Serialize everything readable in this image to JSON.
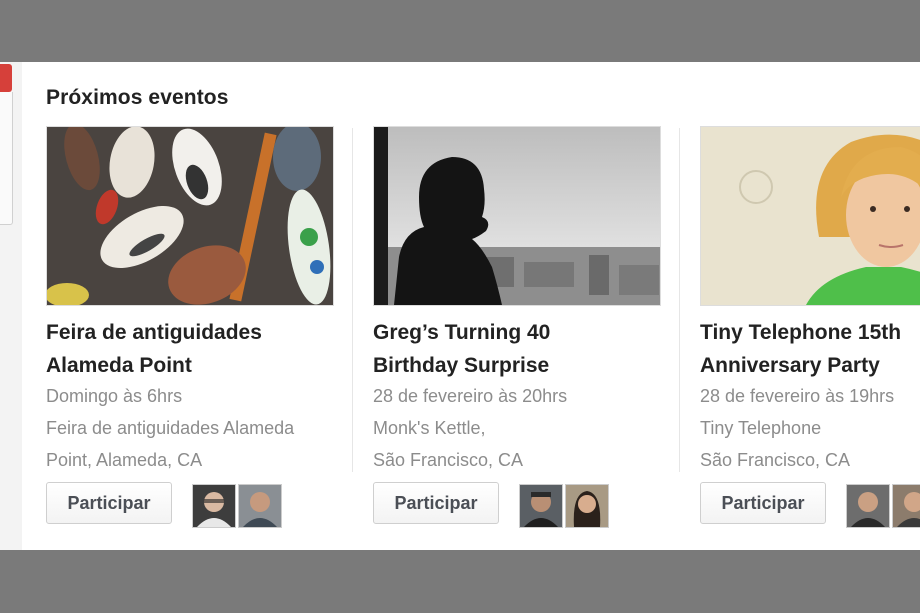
{
  "section_title": "Próximos eventos",
  "events": [
    {
      "title": "Feira de antiguidades\nAlameda Point",
      "date": "Domingo às 6hrs",
      "location_line1": "Feira de antiguidades Alameda",
      "location_line2": "Point, Alameda, CA",
      "join_label": "Participar",
      "photo_icon": "antique-surfboards-photo"
    },
    {
      "title": "Greg’s Turning 40\nBirthday Surprise",
      "date": "28 de fevereiro às 20hrs",
      "location_line1": "Monk's Kettle,",
      "location_line2": "São Francisco, CA",
      "join_label": "Participar",
      "photo_icon": "silhouette-window-photo"
    },
    {
      "title": "Tiny Telephone 15th\nAnniversary Party",
      "date": "28 de fevereiro às 19hrs",
      "location_line1": "Tiny Telephone",
      "location_line2": "São Francisco, CA",
      "join_label": "Participar",
      "photo_icon": "portrait-photo"
    }
  ]
}
